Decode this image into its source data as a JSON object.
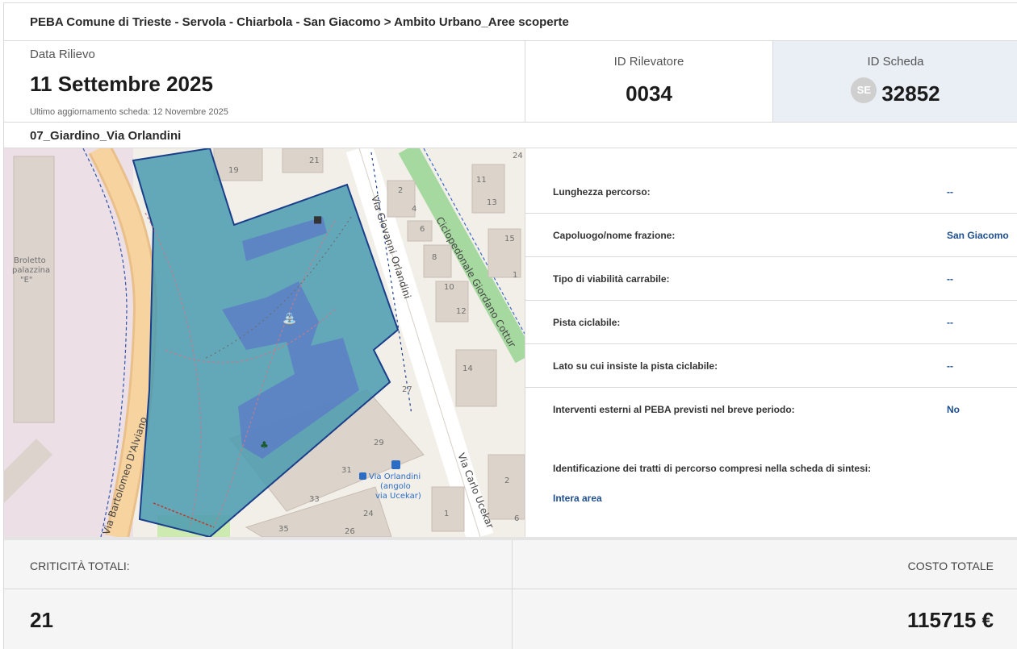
{
  "breadcrumb": "PEBA Comune di Trieste - Servola - Chiarbola - San Giacomo > Ambito Urbano_Aree scoperte",
  "survey": {
    "date_label": "Data Rilievo",
    "date_value": "11 Settembre 2025",
    "last_updated": "Ultimo aggiornamento scheda: 12 Novembre 2025",
    "rilevatore_label": "ID Rilevatore",
    "rilevatore_value": "0034",
    "scheda_label": "ID Scheda",
    "scheda_badge": "SE",
    "scheda_value": "32852"
  },
  "area_name": "07_Giardino_Via Orlandini",
  "map": {
    "labels": {
      "broletto": [
        "Broletto",
        "palazzina",
        "\"E\""
      ],
      "via_orlandini": "Via Giovanni Orlandini",
      "ciclopedonale": "Ciclopedonale Giordano Cottur",
      "via_alviano": "Via Bartolomeo D'Alviano",
      "via_ucekar": "Via Carlo Ucekar",
      "bus_stop": [
        "Via Orlandini",
        "(angolo",
        "via Ucekar)"
      ],
      "numbers": [
        "19",
        "21",
        "24",
        "2",
        "4",
        "6",
        "8",
        "10",
        "11",
        "12",
        "13",
        "15",
        "1",
        "14",
        "27",
        "29",
        "31",
        "33",
        "35",
        "24",
        "26",
        "1",
        "2",
        "6"
      ]
    },
    "colors": {
      "area_fill": "#4a9bb0",
      "area_stroke": "#1a3e8a",
      "inner_fill": "#5c7fc4",
      "road_main": "#f7c98b",
      "cycle": "#a6d9a0",
      "building": "#dcd4ca"
    }
  },
  "details": [
    {
      "label": "Lunghezza percorso:",
      "value": "--"
    },
    {
      "label": "Capoluogo/nome frazione:",
      "value": "San Giacomo"
    },
    {
      "label": "Tipo di viabilità carrabile:",
      "value": "--"
    },
    {
      "label": "Pista ciclabile:",
      "value": "--"
    },
    {
      "label": "Lato su cui insiste la pista ciclabile:",
      "value": "--"
    },
    {
      "label": "Interventi esterni al PEBA previsti nel breve periodo:",
      "value": "No"
    }
  ],
  "tratti": {
    "label": "Identificazione dei tratti di percorso compresi nella scheda di sintesi:",
    "value": "Intera area"
  },
  "summary": {
    "criticita_label": "CRITICITÀ TOTALI:",
    "criticita_value": "21",
    "costo_label": "COSTO TOTALE",
    "costo_value": "115715 €"
  }
}
